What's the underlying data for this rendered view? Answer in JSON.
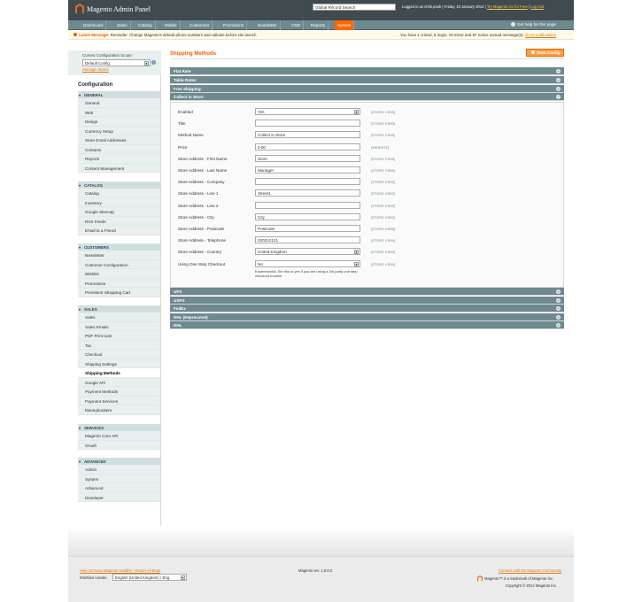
{
  "header": {
    "logo_text": "Magento Admin Panel",
    "search_value": "Global Record Search",
    "logged_in": "Logged in as chris.pook",
    "date": "Friday, 10 January 2014",
    "try_link": "Try Magento Go for Free",
    "logout": "Log Out"
  },
  "nav": {
    "items": [
      "Dashboard",
      "Sales",
      "Catalog",
      "Mobile",
      "Customers",
      "Promotions",
      "Newsletter",
      "CMS",
      "Reports",
      "System"
    ],
    "active": "System",
    "help": "Get help for this page"
  },
  "notice": {
    "latest_label": "Latest Message:",
    "message": "Reminder: Change Magento's default phone numbers and callouts before site launch",
    "summary": "You have 1 critical, 6 major, 19 minor and 87 notice unread message(s).",
    "go_link": "Go to notifications"
  },
  "sidebar": {
    "scope_label": "Current Configuration Scope:",
    "scope_value": "Default Config",
    "manage_stores": "Manage Stores",
    "title": "Configuration",
    "sections": [
      {
        "name": "GENERAL",
        "items": [
          "General",
          "Web",
          "Design",
          "Currency Setup",
          "Store Email Addresses",
          "Contacts",
          "Reports",
          "Content Management"
        ]
      },
      {
        "name": "CATALOG",
        "items": [
          "Catalog",
          "Inventory",
          "Google Sitemap",
          "RSS Feeds",
          "Email to a Friend"
        ]
      },
      {
        "name": "CUSTOMERS",
        "items": [
          "Newsletter",
          "Customer Configuration",
          "Wishlist",
          "Promotions",
          "Persistent Shopping Cart"
        ]
      },
      {
        "name": "SALES",
        "items": [
          "Sales",
          "Sales Emails",
          "PDF Print-outs",
          "Tax",
          "Checkout",
          "Shipping Settings",
          "Shipping Methods",
          "Google API",
          "Payment Methods",
          "Payment Services",
          "Moneybookers"
        ]
      },
      {
        "name": "SERVICES",
        "items": [
          "Magento Core API",
          "OAuth"
        ]
      },
      {
        "name": "ADVANCED",
        "items": [
          "Admin",
          "System",
          "Advanced",
          "Developer"
        ]
      }
    ],
    "active_item": "Shipping Methods"
  },
  "main": {
    "title": "Shipping Methods",
    "save_label": "Save Config",
    "top_groups": [
      "Flat Rate",
      "Table Rates",
      "Free Shipping",
      "Collect in Store"
    ],
    "bottom_groups": [
      "UPS",
      "USPS",
      "FedEx",
      "DHL (Deprecated)",
      "DHL"
    ],
    "fields": [
      {
        "label": "Enabled",
        "value": "Yes",
        "type": "select",
        "scope": "[STORE VIEW]"
      },
      {
        "label": "Title",
        "value": "",
        "type": "text",
        "scope": "[STORE VIEW]"
      },
      {
        "label": "Method Name",
        "value": "Collect in Store",
        "type": "text",
        "scope": "[STORE VIEW]"
      },
      {
        "label": "Price",
        "value": "0.00",
        "type": "text",
        "scope": "[WEBSITE]"
      },
      {
        "label": "Store Address - First Name",
        "value": "Store",
        "type": "text",
        "scope": "[STORE VIEW]"
      },
      {
        "label": "Store Address - Last Name",
        "value": "Manager",
        "type": "text",
        "scope": "[STORE VIEW]"
      },
      {
        "label": "Store Address - Company",
        "value": "",
        "type": "text",
        "scope": "[STORE VIEW]"
      },
      {
        "label": "Store Address - Line 1",
        "value": "Street1",
        "type": "text",
        "scope": "[STORE VIEW]"
      },
      {
        "label": "Store Address - Line 2",
        "value": "",
        "type": "text",
        "scope": "[STORE VIEW]"
      },
      {
        "label": "Store Address - City",
        "value": "City",
        "type": "text",
        "scope": "[STORE VIEW]"
      },
      {
        "label": "Store Address - Postcode",
        "value": "Postcode",
        "type": "text",
        "scope": "[STORE VIEW]"
      },
      {
        "label": "Store Address - Telephone",
        "value": "020212121",
        "type": "text",
        "scope": "[STORE VIEW]"
      },
      {
        "label": "Store Address - Country",
        "value": "United Kingdom",
        "type": "select",
        "scope": "[STORE VIEW]"
      },
      {
        "label": "Using One Step Checkout",
        "value": "No",
        "type": "select",
        "scope": "[STORE VIEW]"
      }
    ],
    "checkout_note": "Experimental. Set this to yes if you are using a 3rd party one step checkout module."
  },
  "footer": {
    "help_link": "Help Us Keep Magento Healthy - Report All Bugs",
    "locale_label": "Interface Locale:",
    "locale_value": "English (United Kingdom) / Eng",
    "version": "Magento ver. 1.8.0.0",
    "community_link": "Connect with the Magento Community",
    "trademark": "Magento™ is a trademark of Magento Inc.",
    "copyright": "Copyright © 2014 Magento Inc."
  },
  "colors": {
    "header_bg": "#3f4b4f",
    "nav_bg": "#6f8991",
    "accent": "#ff6600",
    "section_head": "#d1dedf"
  }
}
